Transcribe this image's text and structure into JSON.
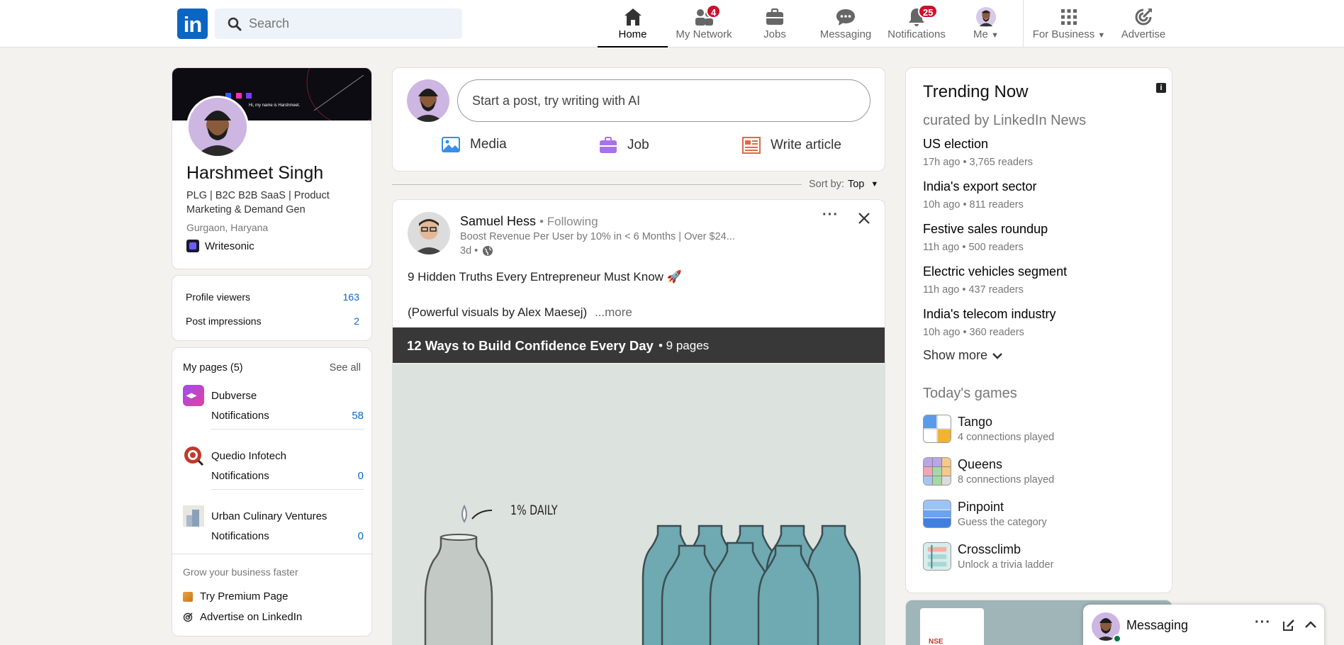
{
  "nav": {
    "logo": "in",
    "search_placeholder": "Search",
    "items": [
      {
        "label": "Home"
      },
      {
        "label": "My Network",
        "badge": "4"
      },
      {
        "label": "Jobs"
      },
      {
        "label": "Messaging"
      },
      {
        "label": "Notifications",
        "badge": "25"
      },
      {
        "label": "Me"
      },
      {
        "label": "For Business"
      },
      {
        "label": "Advertise"
      }
    ]
  },
  "profile": {
    "name": "Harshmeet Singh",
    "headline": "PLG | B2C B2B SaaS | Product Marketing & Demand Gen",
    "location": "Gurgaon, Haryana",
    "company": "Writesonic",
    "banner_text": "Hi, my name is Harshmeet."
  },
  "stats": [
    {
      "label": "Profile viewers",
      "value": "163"
    },
    {
      "label": "Post impressions",
      "value": "2"
    }
  ],
  "pages": {
    "title": "My pages (5)",
    "see_all": "See all",
    "items": [
      {
        "name": "Dubverse",
        "sub": "Notifications",
        "count": "58"
      },
      {
        "name": "Quedio Infotech",
        "sub": "Notifications",
        "count": "0"
      },
      {
        "name": "Urban Culinary Ventures",
        "sub": "Notifications",
        "count": "0"
      }
    ]
  },
  "grow": {
    "title": "Grow your business faster",
    "premium": "Try Premium Page",
    "advertise": "Advertise on LinkedIn"
  },
  "composer": {
    "placeholder": "Start a post, try writing with AI",
    "actions": [
      "Media",
      "Job",
      "Write article"
    ]
  },
  "sort": {
    "label": "Sort by:",
    "value": "Top"
  },
  "post": {
    "author": "Samuel Hess",
    "following": "• Following",
    "headline": "Boost Revenue Per User by 10% in < 6 Months | Over $24...",
    "time": "3d •",
    "text1": "9 Hidden Truths Every Entrepreneur Must Know 🚀",
    "text2": "(Powerful visuals by Alex Maesej)",
    "more": "...more",
    "doc_title": "12 Ways to Build Confidence Every Day",
    "doc_pages": "• 9 pages",
    "illustration_label": "1% DAILY"
  },
  "trending": {
    "title": "Trending Now",
    "subtitle": "curated by LinkedIn News",
    "items": [
      {
        "title": "US election",
        "meta": "17h ago • 3,765 readers"
      },
      {
        "title": "India's export sector",
        "meta": "10h ago • 811 readers"
      },
      {
        "title": "Festive sales roundup",
        "meta": "11h ago • 500 readers"
      },
      {
        "title": "Electric vehicles segment",
        "meta": "11h ago • 437 readers"
      },
      {
        "title": "India's telecom industry",
        "meta": "10h ago • 360 readers"
      }
    ],
    "show_more": "Show more",
    "games_title": "Today's games",
    "games": [
      {
        "name": "Tango",
        "meta": "4 connections played"
      },
      {
        "name": "Queens",
        "meta": "8 connections played"
      },
      {
        "name": "Pinpoint",
        "meta": "Guess the category"
      },
      {
        "name": "Crossclimb",
        "meta": "Unlock a trivia ladder"
      }
    ]
  },
  "ad": {
    "logo_text": "NSE"
  },
  "messaging": {
    "label": "Messaging"
  },
  "colors": {
    "brand": "#0a66c2",
    "badge": "#cb112d",
    "bg": "#f4f2ee"
  }
}
